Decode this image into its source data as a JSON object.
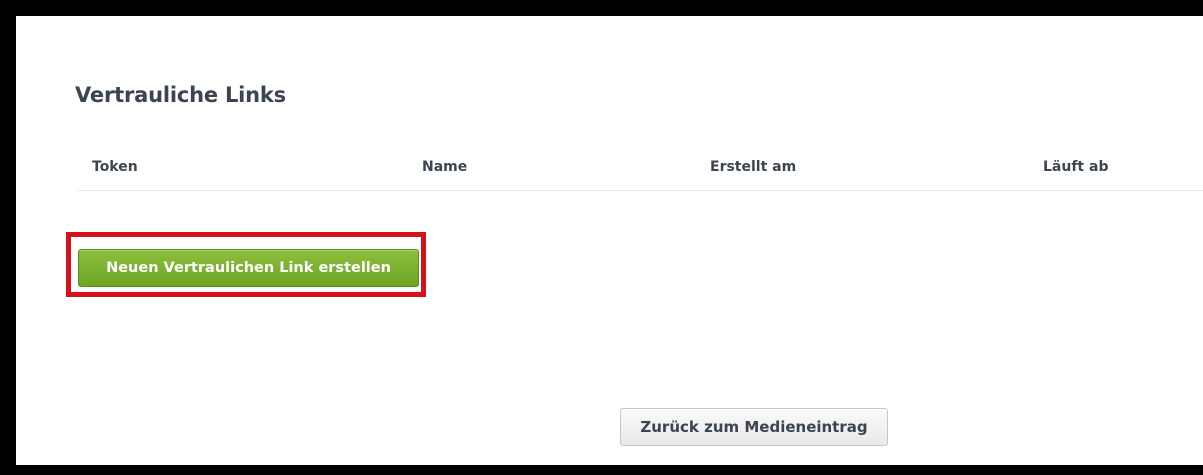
{
  "section": {
    "title": "Vertrauliche Links"
  },
  "table": {
    "columns": [
      "Token",
      "Name",
      "Erstellt am",
      "Läuft ab"
    ],
    "rows": []
  },
  "actions": {
    "create_label": "Neuen Vertraulichen Link erstellen",
    "back_label": "Zurück zum Medieneintrag"
  },
  "colors": {
    "primary_button": "#78ad2d",
    "highlight_border": "#d4121b",
    "secondary_button": "#efefef",
    "text": "#3b4450"
  }
}
